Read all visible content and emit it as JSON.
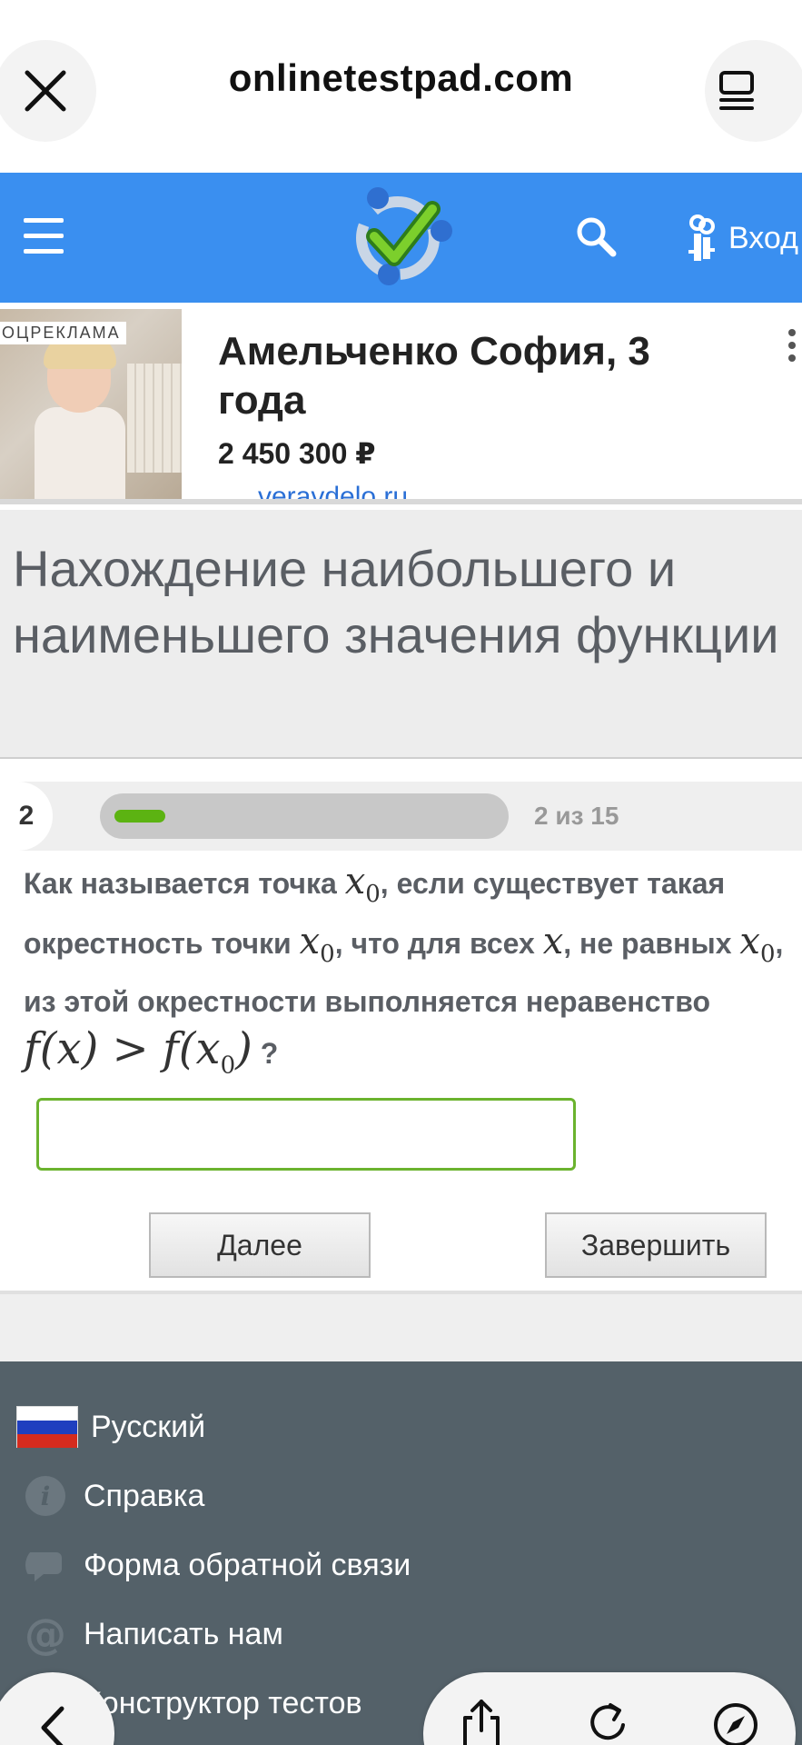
{
  "browser": {
    "url": "onlinetestpad.com",
    "close_icon": "close-icon",
    "tabs_icon": "tabs-icon"
  },
  "site_header": {
    "login_label": "Вход",
    "brand_color": "#3a8ff0"
  },
  "ad": {
    "badge": "ОЦРЕКЛАМА",
    "title": "Амельченко София, 3 года",
    "price": "2 450 300 ₽",
    "link": "veravdelo.ru"
  },
  "test": {
    "title": "Нахождение наибольшего и наименьшего значения функции",
    "question_number": "2",
    "progress_text": "2 из 15",
    "progress_fraction": 0.1333,
    "question": {
      "part1": "Как называется точка ",
      "part2": ", если существует такая окрестность точки ",
      "part3": ", что для всех ",
      "part4": ", не равных ",
      "part5": ", из этой окрестности выполняется неравенство ",
      "part6": " ?",
      "var_x": "x",
      "sub_0": "0",
      "ineq_left": "f(x) > f(x",
      "ineq_sub": "0",
      "ineq_right": ")"
    },
    "answer_value": "",
    "next_label": "Далее",
    "finish_label": "Завершить",
    "accent_color": "#5cb312"
  },
  "footer": {
    "items": [
      {
        "label": "Русский",
        "icon": "russia-flag-icon"
      },
      {
        "label": "Справка",
        "icon": "info-icon"
      },
      {
        "label": "Форма обратной связи",
        "icon": "chat-icon"
      },
      {
        "label": "Написать нам",
        "icon": "at-icon"
      },
      {
        "label": "Конструктор тестов",
        "icon": ""
      }
    ]
  }
}
